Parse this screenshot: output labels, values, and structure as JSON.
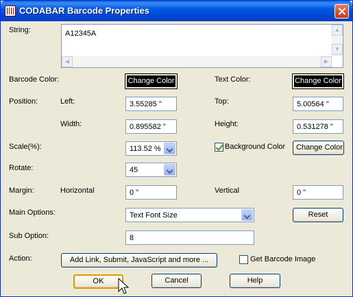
{
  "window": {
    "title": "CODABAR Barcode Properties"
  },
  "string": {
    "label": "String:",
    "value": "A12345A"
  },
  "barcode_color": {
    "label": "Barcode Color:",
    "button": "Change Color",
    "color": "#000000"
  },
  "text_color": {
    "label": "Text Color:",
    "button": "Change Color",
    "color": "#000000"
  },
  "position": {
    "label": "Position:",
    "left_label": "Left:",
    "left_value": "3.55285 \"",
    "top_label": "Top:",
    "top_value": "5.00564 \"",
    "width_label": "Width:",
    "width_value": "0.895582 \"",
    "height_label": "Height:",
    "height_value": "0.531278 \""
  },
  "scale": {
    "label": "Scale(%):",
    "value": "113.52 %"
  },
  "background": {
    "label": "Background Color",
    "checked": true,
    "button": "Change Color"
  },
  "rotate": {
    "label": "Rotate:",
    "value": "45"
  },
  "margin": {
    "label": "Margin:",
    "horizontal_label": "Horizontal",
    "horizontal_value": "0 \"",
    "vertical_label": "Vertical",
    "vertical_value": "0 \""
  },
  "main_options": {
    "label": "Main Options:",
    "value": "Text Font Size",
    "reset": "Reset"
  },
  "sub_option": {
    "label": "Sub Option:",
    "value": "8"
  },
  "action": {
    "label": "Action:",
    "button": "Add Link, Submit, JavaScript and more ...",
    "get_image_label": "Get Barcode Image",
    "get_image_checked": false
  },
  "footer": {
    "ok": "OK",
    "cancel": "Cancel",
    "help": "Help"
  },
  "icons": {
    "app": "barcode-document-icon",
    "close": "close-icon",
    "dropdown": "chevron-down-icon",
    "cursor": "mouse-pointer-icon"
  }
}
